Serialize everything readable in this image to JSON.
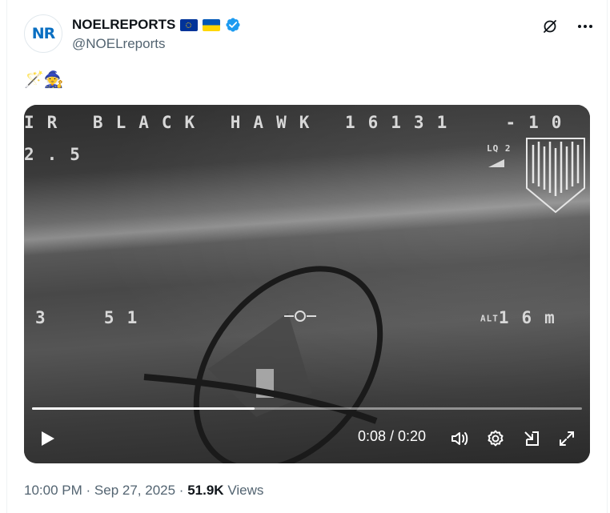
{
  "author": {
    "avatar_text": "NR",
    "display_name": "NOELREPORTS",
    "handle": "@NOELreports",
    "verified": true,
    "flags": [
      "eu-flag",
      "ukraine-flag"
    ]
  },
  "header_actions": [
    "grok-icon",
    "more-icon"
  ],
  "tweet": {
    "text": "🪄🧙"
  },
  "video": {
    "osd": {
      "title": "IR BLACK HAWK 16131  -10",
      "left_value": "2.5",
      "lq": "LQ 2",
      "mid_value": "3  51",
      "alt_label": "ALT",
      "alt_value": "16m"
    },
    "progress_fraction": 0.405,
    "time_display": "0:08 / 0:20",
    "controls": [
      "play-icon",
      "volume-icon",
      "settings-icon",
      "pop-out-icon",
      "fullscreen-icon"
    ]
  },
  "meta": {
    "time": "10:00 PM",
    "separator": "·",
    "date": "Sep 27, 2025",
    "views_count": "51.9K",
    "views_label": "Views"
  },
  "colors": {
    "text_primary": "#0f1419",
    "text_secondary": "#536471",
    "verified_blue": "#1d9bf0",
    "avatar_brand": "#0a6fc2"
  }
}
